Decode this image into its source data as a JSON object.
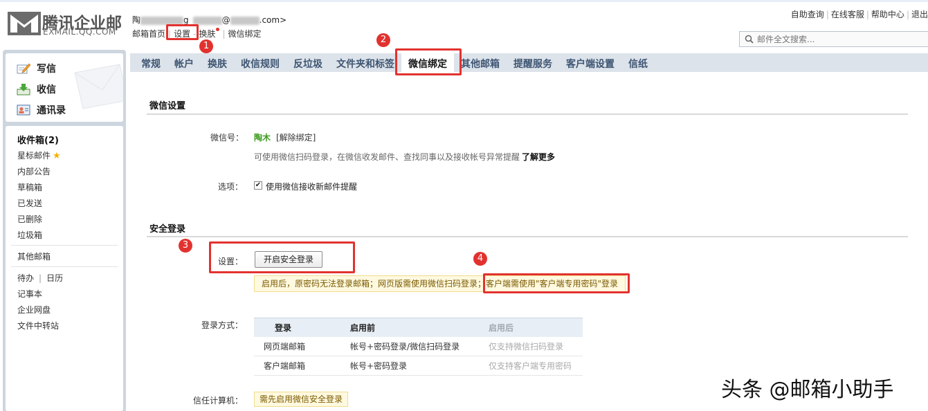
{
  "header": {
    "logo_cn": "腾讯企业邮",
    "logo_en": "EXMAIL.QQ.COM",
    "email_prefix": "陶",
    "email_middle": "g_",
    "email_at": "@",
    "email_suffix": ".com>",
    "nav": [
      "邮箱首页",
      "设置",
      "换肤",
      "微信绑定"
    ],
    "top_links": [
      "自助查询",
      "在线客服",
      "帮助中心",
      "退出"
    ],
    "search_placeholder": "邮件全文搜索..."
  },
  "sidebar": {
    "compose": "写信",
    "receive": "收信",
    "contacts": "通讯录",
    "folders": [
      "收件箱(2)",
      "星标邮件",
      "内部公告",
      "草稿箱",
      "已发送",
      "已删除",
      "垃圾箱"
    ],
    "other_mailbox": "其他邮箱",
    "todo": "待办",
    "calendar": "日历",
    "apps": [
      "记事本",
      "企业网盘",
      "文件中转站"
    ]
  },
  "tabs": [
    "常规",
    "帐户",
    "换肤",
    "收信规则",
    "反垃圾",
    "文件夹和标签",
    "微信绑定",
    "其他邮箱",
    "提醒服务",
    "客户端设置",
    "信纸"
  ],
  "active_tab": "微信绑定",
  "wechat_section": {
    "title": "微信设置",
    "wechat_label": "微信号：",
    "wechat_name": "陶木",
    "unbind": "[解除绑定]",
    "description": "可使用微信扫码登录，在微信收发邮件、查找同事以及接收帐号异常提醒",
    "learn_more": "了解更多",
    "option_label": "选项：",
    "option_text": "使用微信接收新邮件提醒",
    "option_checked": true
  },
  "secure_section": {
    "title": "安全登录",
    "setting_label": "设置：",
    "button": "开启安全登录",
    "notice": "启用后，原密码无法登录邮箱；网页版需使用微信扫码登录；客户端需使用\"客户端专用密码\"登录",
    "login_mode_label": "登录方式：",
    "table": {
      "headers": [
        "登录",
        "启用前",
        "启用后"
      ],
      "rows": [
        [
          "网页端邮箱",
          "帐号+密码登录/微信扫码登录",
          "仅支持微信扫码登录"
        ],
        [
          "客户端邮箱",
          "帐号+密码登录",
          "仅支持客户端专用密码"
        ]
      ]
    },
    "trusted_label": "信任计算机：",
    "trusted_value": "需先启用微信安全登录"
  },
  "annotations": [
    "1",
    "2",
    "3",
    "4"
  ],
  "watermark": "头条 @邮箱小助手",
  "colors": {
    "accent_red": "#e2322f",
    "tab_bar": "#dde3ea",
    "sidebar_bg": "#cdd6df",
    "wechat_green": "#3c9b1e",
    "notice_bg": "#fff9e0"
  }
}
